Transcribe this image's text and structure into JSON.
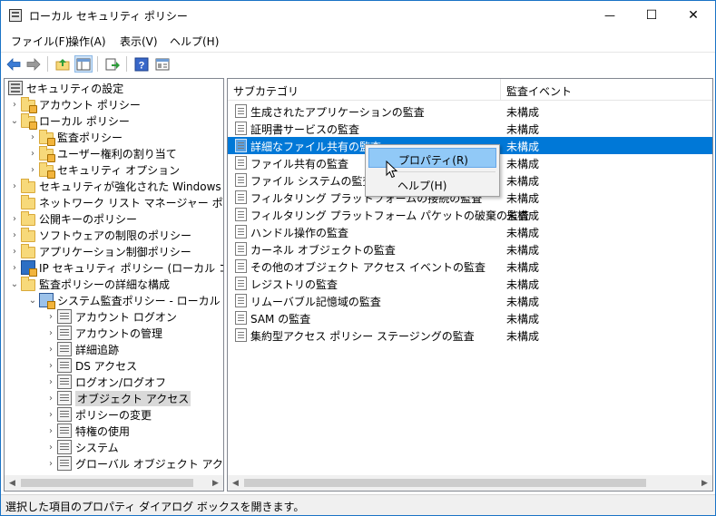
{
  "window": {
    "title": "ローカル セキュリティ ポリシー",
    "controls": {
      "minimize": "—",
      "maximize": "☐",
      "close": "✕"
    }
  },
  "menu": [
    "ファイル(F)",
    "操作(A)",
    "表示(V)",
    "ヘルプ(H)"
  ],
  "toolbar": {
    "icons": [
      "back-icon",
      "forward-icon",
      "up-folder-icon",
      "show-hide-tree-icon",
      "export-list-icon",
      "help-icon",
      "properties-icon"
    ]
  },
  "tree": {
    "items": [
      {
        "label": "セキュリティの設定",
        "arrow": "",
        "icon": "root"
      },
      {
        "label": "アカウント ポリシー",
        "arrow": "›",
        "icon": "folder-lock"
      },
      {
        "label": "ローカル ポリシー",
        "arrow": "⌄",
        "icon": "folder-lock"
      },
      {
        "label": "監査ポリシー",
        "arrow": "›",
        "icon": "folder-lock"
      },
      {
        "label": "ユーザー権利の割り当て",
        "arrow": "›",
        "icon": "folder-lock"
      },
      {
        "label": "セキュリティ オプション",
        "arrow": "›",
        "icon": "folder-lock"
      },
      {
        "label": "セキュリティが強化された Windows ファイアウォール",
        "arrow": "›",
        "icon": "folder"
      },
      {
        "label": "ネットワーク リスト マネージャー ポリシー",
        "arrow": "",
        "icon": "folder"
      },
      {
        "label": "公開キーのポリシー",
        "arrow": "›",
        "icon": "folder"
      },
      {
        "label": "ソフトウェアの制限のポリシー",
        "arrow": "›",
        "icon": "folder"
      },
      {
        "label": "アプリケーション制御ポリシー",
        "arrow": "›",
        "icon": "folder"
      },
      {
        "label": "IP セキュリティ ポリシー (ローカル コンピューター)",
        "arrow": "›",
        "icon": "ip"
      },
      {
        "label": "監査ポリシーの詳細な構成",
        "arrow": "⌄",
        "icon": "folder"
      },
      {
        "label": "システム監査ポリシー - ローカル グループ ポリシー オブジェクト",
        "arrow": "⌄",
        "icon": "computer"
      },
      {
        "label": "アカウント ログオン",
        "arrow": "›",
        "icon": "policy"
      },
      {
        "label": "アカウントの管理",
        "arrow": "›",
        "icon": "policy"
      },
      {
        "label": "詳細追跡",
        "arrow": "›",
        "icon": "policy"
      },
      {
        "label": "DS アクセス",
        "arrow": "›",
        "icon": "policy"
      },
      {
        "label": "ログオン/ログオフ",
        "arrow": "›",
        "icon": "policy"
      },
      {
        "label": "オブジェクト アクセス",
        "arrow": "›",
        "icon": "policy",
        "selected": true
      },
      {
        "label": "ポリシーの変更",
        "arrow": "›",
        "icon": "policy"
      },
      {
        "label": "特権の使用",
        "arrow": "›",
        "icon": "policy"
      },
      {
        "label": "システム",
        "arrow": "›",
        "icon": "policy"
      },
      {
        "label": "グローバル オブジェクト アクセスの監査",
        "arrow": "›",
        "icon": "policy"
      }
    ]
  },
  "list": {
    "columns": [
      "サブカテゴリ",
      "監査イベント"
    ],
    "rows": [
      {
        "name": "生成されたアプリケーションの監査",
        "event": "未構成"
      },
      {
        "name": "証明書サービスの監査",
        "event": "未構成"
      },
      {
        "name": "詳細なファイル共有の監査",
        "event": "未構成",
        "selected": true
      },
      {
        "name": "ファイル共有の監査",
        "event": "未構成"
      },
      {
        "name": "ファイル システムの監査",
        "event": "未構成"
      },
      {
        "name": "フィルタリング プラットフォームの接続の監査",
        "event": "未構成"
      },
      {
        "name": "フィルタリング プラットフォーム パケットの破棄の監査",
        "event": "未構成"
      },
      {
        "name": "ハンドル操作の監査",
        "event": "未構成"
      },
      {
        "name": "カーネル オブジェクトの監査",
        "event": "未構成"
      },
      {
        "name": "その他のオブジェクト アクセス イベントの監査",
        "event": "未構成"
      },
      {
        "name": "レジストリの監査",
        "event": "未構成"
      },
      {
        "name": "リムーバブル記憶域の監査",
        "event": "未構成"
      },
      {
        "name": "SAM の監査",
        "event": "未構成"
      },
      {
        "name": "集約型アクセス ポリシー ステージングの監査",
        "event": "未構成"
      }
    ]
  },
  "context_menu": {
    "items": [
      "プロパティ(R)",
      "ヘルプ(H)"
    ]
  },
  "status": {
    "text": "選択した項目のプロパティ ダイアログ ボックスを開きます。"
  },
  "colors": {
    "selection": "#0078d7",
    "menu_hover": "#91c9f7",
    "window_border": "#1a73c6"
  }
}
